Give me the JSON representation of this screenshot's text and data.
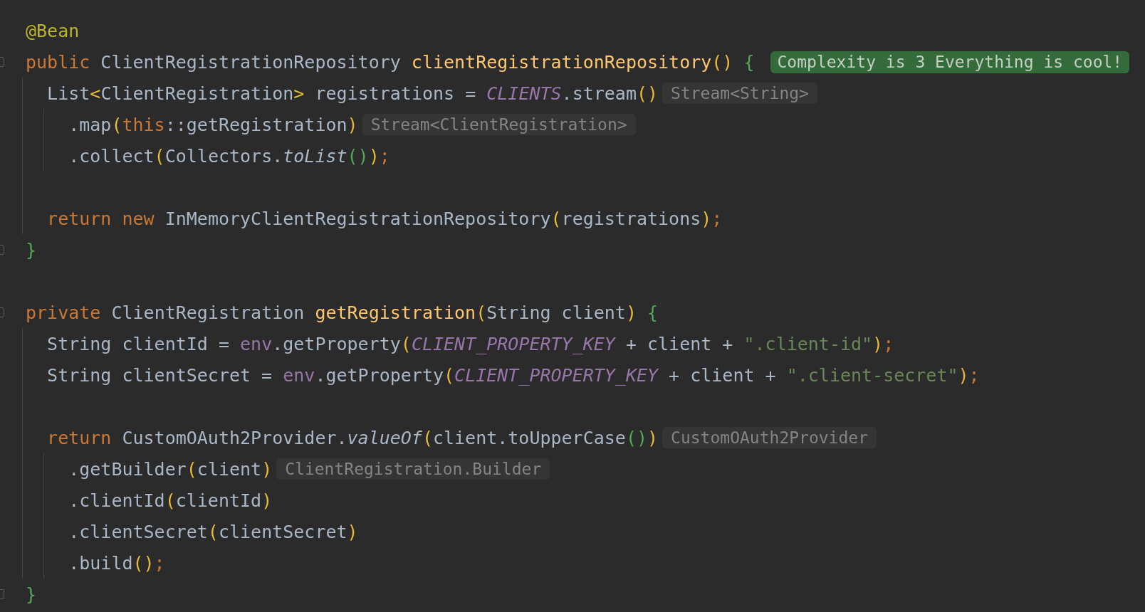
{
  "editor": {
    "lines": [
      {
        "folding": false,
        "tokens": [
          {
            "kind": "annotation",
            "text": "@Bean"
          }
        ]
      },
      {
        "folding": true,
        "tokens": [
          {
            "kind": "keyword",
            "text": "public "
          },
          {
            "kind": "plain",
            "text": "ClientRegistrationRepository "
          },
          {
            "kind": "method",
            "text": "clientRegistrationRepository"
          },
          {
            "kind": "paren1",
            "text": "()"
          },
          {
            "kind": "paren2",
            "text": " {"
          }
        ],
        "badge": "Complexity is 3 Everything is cool!"
      },
      {
        "folding": false,
        "tokens": [
          {
            "kind": "plain",
            "text": "  List"
          },
          {
            "kind": "paren1",
            "text": "<"
          },
          {
            "kind": "plain",
            "text": "ClientRegistration"
          },
          {
            "kind": "paren1",
            "text": ">"
          },
          {
            "kind": "plain",
            "text": " registrations = "
          },
          {
            "kind": "static",
            "text": "CLIENTS"
          },
          {
            "kind": "plain",
            "text": ".stream"
          },
          {
            "kind": "paren1",
            "text": "()"
          }
        ],
        "hint": "Stream<String>"
      },
      {
        "folding": false,
        "tokens": [
          {
            "kind": "plain",
            "text": "    .map"
          },
          {
            "kind": "paren1",
            "text": "("
          },
          {
            "kind": "keyword",
            "text": "this"
          },
          {
            "kind": "plain",
            "text": "::getRegistration"
          },
          {
            "kind": "paren1",
            "text": ")"
          }
        ],
        "hint": "Stream<ClientRegistration>"
      },
      {
        "folding": false,
        "tokens": [
          {
            "kind": "plain",
            "text": "    .collect"
          },
          {
            "kind": "paren1",
            "text": "("
          },
          {
            "kind": "plain",
            "text": "Collectors."
          },
          {
            "kind": "italic",
            "text": "toList"
          },
          {
            "kind": "paren2",
            "text": "()"
          },
          {
            "kind": "paren1",
            "text": ")"
          },
          {
            "kind": "keyword",
            "text": ";"
          }
        ]
      },
      {
        "folding": false
      },
      {
        "folding": false,
        "tokens": [
          {
            "kind": "keyword",
            "text": "  return new "
          },
          {
            "kind": "plain",
            "text": "InMemoryClientRegistrationRepository"
          },
          {
            "kind": "paren1",
            "text": "("
          },
          {
            "kind": "plain",
            "text": "registrations"
          },
          {
            "kind": "paren1",
            "text": ")"
          },
          {
            "kind": "keyword",
            "text": ";"
          }
        ]
      },
      {
        "folding": true,
        "tokens": [
          {
            "kind": "paren2",
            "text": "}"
          }
        ]
      },
      {
        "folding": false
      },
      {
        "folding": true,
        "tokens": [
          {
            "kind": "keyword",
            "text": "private "
          },
          {
            "kind": "plain",
            "text": "ClientRegistration "
          },
          {
            "kind": "method",
            "text": "getRegistration"
          },
          {
            "kind": "paren1",
            "text": "("
          },
          {
            "kind": "plain",
            "text": "String client"
          },
          {
            "kind": "paren1",
            "text": ")"
          },
          {
            "kind": "paren2",
            "text": " {"
          }
        ]
      },
      {
        "folding": false,
        "tokens": [
          {
            "kind": "plain",
            "text": "  String clientId = "
          },
          {
            "kind": "field",
            "text": "env"
          },
          {
            "kind": "plain",
            "text": ".getProperty"
          },
          {
            "kind": "paren1",
            "text": "("
          },
          {
            "kind": "static",
            "text": "CLIENT_PROPERTY_KEY"
          },
          {
            "kind": "plain",
            "text": " + client + "
          },
          {
            "kind": "string",
            "text": "\".client-id\""
          },
          {
            "kind": "paren1",
            "text": ")"
          },
          {
            "kind": "keyword",
            "text": ";"
          }
        ]
      },
      {
        "folding": false,
        "tokens": [
          {
            "kind": "plain",
            "text": "  String clientSecret = "
          },
          {
            "kind": "field",
            "text": "env"
          },
          {
            "kind": "plain",
            "text": ".getProperty"
          },
          {
            "kind": "paren1",
            "text": "("
          },
          {
            "kind": "static",
            "text": "CLIENT_PROPERTY_KEY"
          },
          {
            "kind": "plain",
            "text": " + client + "
          },
          {
            "kind": "string",
            "text": "\".client-secret\""
          },
          {
            "kind": "paren1",
            "text": ")"
          },
          {
            "kind": "keyword",
            "text": ";"
          }
        ]
      },
      {
        "folding": false
      },
      {
        "folding": false,
        "tokens": [
          {
            "kind": "keyword",
            "text": "  return "
          },
          {
            "kind": "plain",
            "text": "CustomOAuth2Provider."
          },
          {
            "kind": "italic",
            "text": "valueOf"
          },
          {
            "kind": "paren1",
            "text": "("
          },
          {
            "kind": "plain",
            "text": "client.toUpperCase"
          },
          {
            "kind": "paren2",
            "text": "()"
          },
          {
            "kind": "paren1",
            "text": ")"
          }
        ],
        "hint": "CustomOAuth2Provider"
      },
      {
        "folding": false,
        "tokens": [
          {
            "kind": "plain",
            "text": "    .getBuilder"
          },
          {
            "kind": "paren1",
            "text": "("
          },
          {
            "kind": "plain",
            "text": "client"
          },
          {
            "kind": "paren1",
            "text": ")"
          }
        ],
        "hint": "ClientRegistration.Builder"
      },
      {
        "folding": false,
        "tokens": [
          {
            "kind": "plain",
            "text": "    .clientId"
          },
          {
            "kind": "paren1",
            "text": "("
          },
          {
            "kind": "plain",
            "text": "clientId"
          },
          {
            "kind": "paren1",
            "text": ")"
          }
        ]
      },
      {
        "folding": false,
        "tokens": [
          {
            "kind": "plain",
            "text": "    .clientSecret"
          },
          {
            "kind": "paren1",
            "text": "("
          },
          {
            "kind": "plain",
            "text": "clientSecret"
          },
          {
            "kind": "paren1",
            "text": ")"
          }
        ]
      },
      {
        "folding": false,
        "tokens": [
          {
            "kind": "plain",
            "text": "    .build"
          },
          {
            "kind": "paren1",
            "text": "()"
          },
          {
            "kind": "keyword",
            "text": ";"
          }
        ]
      },
      {
        "folding": true,
        "tokens": [
          {
            "kind": "paren2",
            "text": "}"
          }
        ]
      }
    ]
  }
}
